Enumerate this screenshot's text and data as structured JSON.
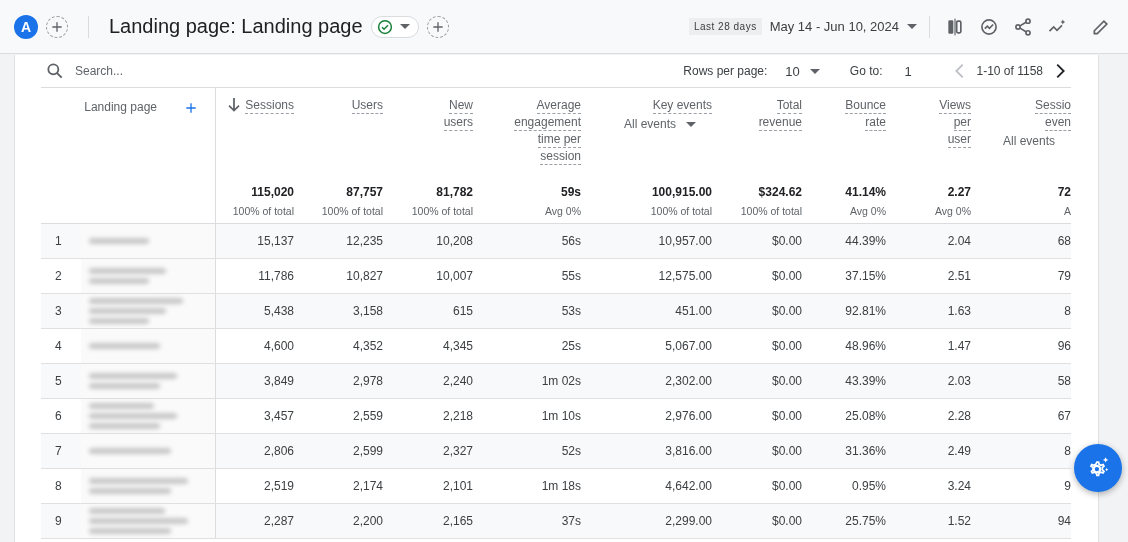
{
  "header": {
    "avatar": "A",
    "title": "Landing page: Landing page",
    "date_chip": "Last 28 days",
    "date_range": "May 14 - Jun 10, 2024"
  },
  "table_toolbar": {
    "search_placeholder": "Search...",
    "rows_label": "Rows per page:",
    "rows_value": "10",
    "goto_label": "Go to:",
    "goto_value": "1",
    "range": "1-10 of 1158",
    "prev_disabled": true,
    "next_disabled": false
  },
  "table": {
    "dimension_header": "Landing page",
    "columns": [
      {
        "label_lines": [
          "Sessions"
        ],
        "sorted": true,
        "total": "115,020",
        "sub": "100% of total"
      },
      {
        "label_lines": [
          "Users"
        ],
        "sorted": false,
        "total": "87,757",
        "sub": "100% of total"
      },
      {
        "label_lines": [
          "New",
          "users"
        ],
        "sorted": false,
        "total": "81,782",
        "sub": "100% of total"
      },
      {
        "label_lines": [
          "Average",
          "engagement",
          "time per",
          "session"
        ],
        "sorted": false,
        "total": "59s",
        "sub": "Avg 0%"
      },
      {
        "label_lines": [
          "Key events"
        ],
        "sorted": false,
        "selector": "All events",
        "selector_caret": true,
        "total": "100,915.00",
        "sub": "100% of total"
      },
      {
        "label_lines": [
          "Total",
          "revenue"
        ],
        "sorted": false,
        "total": "$324.62",
        "sub": "100% of total"
      },
      {
        "label_lines": [
          "Bounce",
          "rate"
        ],
        "sorted": false,
        "total": "41.14%",
        "sub": "Avg 0%"
      },
      {
        "label_lines": [
          "Views",
          "per",
          "user"
        ],
        "sorted": false,
        "total": "2.27",
        "sub": "Avg 0%"
      },
      {
        "label_lines": [
          "Sessio",
          "even"
        ],
        "sorted": false,
        "selector": "All events",
        "selector_caret": false,
        "total": "72",
        "sub": "A"
      }
    ],
    "rows": [
      {
        "index": "1",
        "cells": [
          "15,137",
          "12,235",
          "10,208",
          "56s",
          "10,957.00",
          "$0.00",
          "44.39%",
          "2.04",
          "68"
        ]
      },
      {
        "index": "2",
        "cells": [
          "11,786",
          "10,827",
          "10,007",
          "55s",
          "12,575.00",
          "$0.00",
          "37.15%",
          "2.51",
          "79"
        ]
      },
      {
        "index": "3",
        "cells": [
          "5,438",
          "3,158",
          "615",
          "53s",
          "451.00",
          "$0.00",
          "92.81%",
          "1.63",
          "8"
        ]
      },
      {
        "index": "4",
        "cells": [
          "4,600",
          "4,352",
          "4,345",
          "25s",
          "5,067.00",
          "$0.00",
          "48.96%",
          "1.47",
          "96"
        ]
      },
      {
        "index": "5",
        "cells": [
          "3,849",
          "2,978",
          "2,240",
          "1m 02s",
          "2,302.00",
          "$0.00",
          "43.39%",
          "2.03",
          "58"
        ]
      },
      {
        "index": "6",
        "cells": [
          "3,457",
          "2,559",
          "2,218",
          "1m 10s",
          "2,976.00",
          "$0.00",
          "25.08%",
          "2.28",
          "67"
        ]
      },
      {
        "index": "7",
        "cells": [
          "2,806",
          "2,599",
          "2,327",
          "52s",
          "3,816.00",
          "$0.00",
          "31.36%",
          "2.49",
          "8"
        ]
      },
      {
        "index": "8",
        "cells": [
          "2,519",
          "2,174",
          "2,101",
          "1m 18s",
          "4,642.00",
          "$0.00",
          "0.95%",
          "3.24",
          "9"
        ]
      },
      {
        "index": "9",
        "cells": [
          "2,287",
          "2,200",
          "2,165",
          "37s",
          "2,299.00",
          "$0.00",
          "25.75%",
          "1.52",
          "94"
        ]
      }
    ]
  }
}
